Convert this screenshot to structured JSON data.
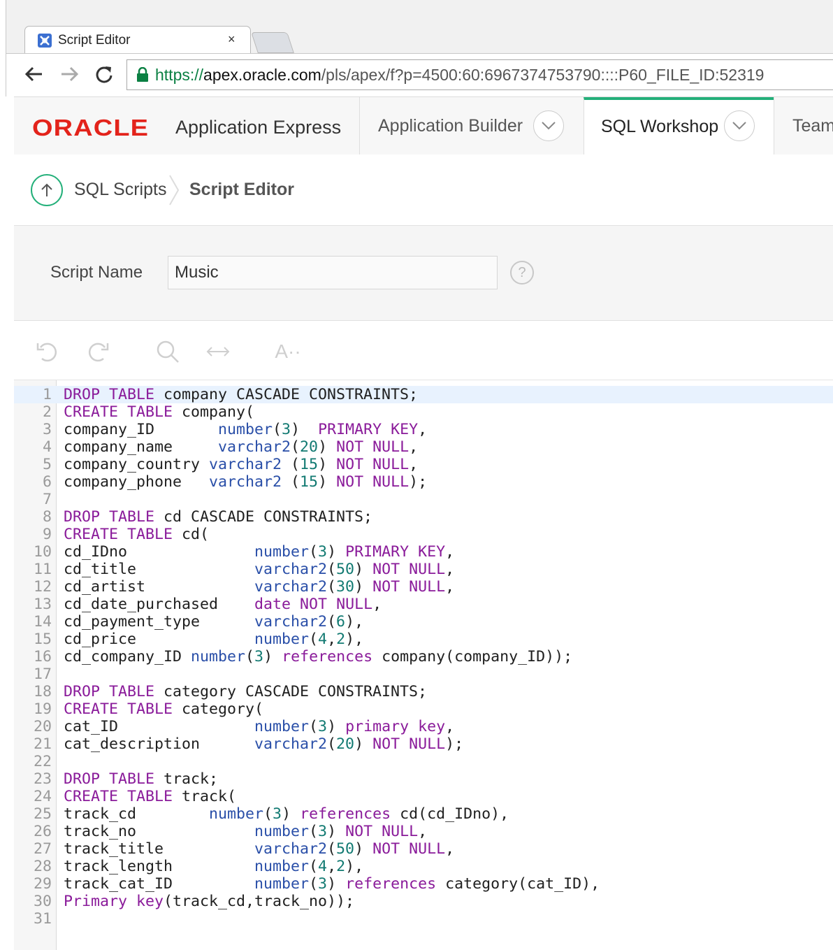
{
  "browser": {
    "tab_title": "Script Editor",
    "tab_close": "×",
    "url_scheme": "https://",
    "url_host": "apex.oracle.com",
    "url_path": "/pls/apex/f?p=4500:60:6967374753790::::P60_FILE_ID:52319"
  },
  "header": {
    "logo_brand": "ORACLE",
    "logo_product": "Application Express",
    "nav": [
      {
        "label": "Application Builder"
      },
      {
        "label": "SQL Workshop"
      },
      {
        "label": "Team"
      }
    ]
  },
  "breadcrumb": {
    "parent": "SQL Scripts",
    "current": "Script Editor"
  },
  "form": {
    "script_name_label": "Script Name",
    "script_name_value": "Music",
    "help": "?"
  },
  "editor_toolbar": {
    "font_size_label": "A··"
  },
  "editor": {
    "lines": [
      "DROP TABLE company CASCADE CONSTRAINTS;",
      "CREATE TABLE company(",
      "company_ID       number(3)  PRIMARY KEY,",
      "company_name     varchar2(20) NOT NULL,",
      "company_country varchar2 (15) NOT NULL,",
      "company_phone   varchar2 (15) NOT NULL);",
      "",
      "DROP TABLE cd CASCADE CONSTRAINTS;",
      "CREATE TABLE cd(",
      "cd_IDno              number(3) PRIMARY KEY,",
      "cd_title             varchar2(50) NOT NULL,",
      "cd_artist            varchar2(30) NOT NULL,",
      "cd_date_purchased    date NOT NULL,",
      "cd_payment_type      varchar2(6),",
      "cd_price             number(4,2),",
      "cd_company_ID number(3) references company(company_ID));",
      "",
      "DROP TABLE category CASCADE CONSTRAINTS;",
      "CREATE TABLE category(",
      "cat_ID               number(3) primary key,",
      "cat_description      varchar2(20) NOT NULL);",
      "",
      "DROP TABLE track;",
      "CREATE TABLE track(",
      "track_cd        number(3) references cd(cd_IDno),",
      "track_no             number(3) NOT NULL,",
      "track_title          varchar2(50) NOT NULL,",
      "track_length         number(4,2),",
      "track_cat_ID         number(3) references category(cat_ID),",
      "Primary key(track_cd,track_no));",
      ""
    ]
  }
}
